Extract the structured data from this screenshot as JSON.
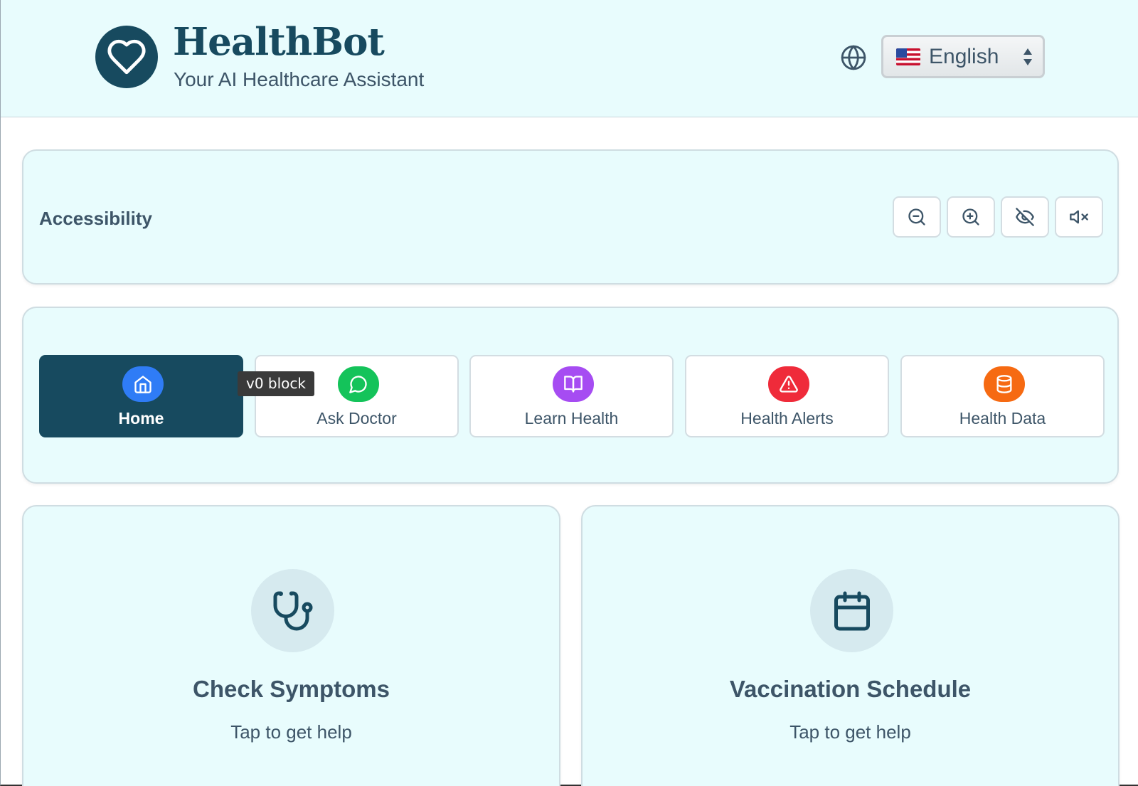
{
  "header": {
    "brand_title": "HealthBot",
    "brand_subtitle": "Your AI Healthcare Assistant",
    "logo_icon": "heart-icon",
    "language": {
      "selected": "English",
      "flag": "us-flag-icon"
    }
  },
  "accessibility": {
    "label": "Accessibility",
    "buttons": [
      {
        "icon": "zoom-out-icon"
      },
      {
        "icon": "zoom-in-icon"
      },
      {
        "icon": "eye-off-icon"
      },
      {
        "icon": "volume-mute-icon"
      }
    ]
  },
  "nav": {
    "items": [
      {
        "label": "Home",
        "icon": "home-icon",
        "color": "#2f7cf6",
        "active": true
      },
      {
        "label": "Ask Doctor",
        "icon": "message-circle-icon",
        "color": "#14c35a",
        "active": false
      },
      {
        "label": "Learn Health",
        "icon": "book-open-icon",
        "color": "#a64cf2",
        "active": false
      },
      {
        "label": "Health Alerts",
        "icon": "alert-triangle-icon",
        "color": "#ef2b3a",
        "active": false
      },
      {
        "label": "Health Data",
        "icon": "database-icon",
        "color": "#f66a12",
        "active": false
      }
    ]
  },
  "tooltip": {
    "text": "v0 block"
  },
  "cards": [
    {
      "title": "Check Symptoms",
      "subtitle": "Tap to get help",
      "icon": "stethoscope-icon"
    },
    {
      "title": "Vaccination Schedule",
      "subtitle": "Tap to get help",
      "icon": "calendar-icon"
    }
  ],
  "colors": {
    "primary": "#174a5f",
    "panel_bg": "#e8fcfd",
    "text": "#3d5568"
  }
}
